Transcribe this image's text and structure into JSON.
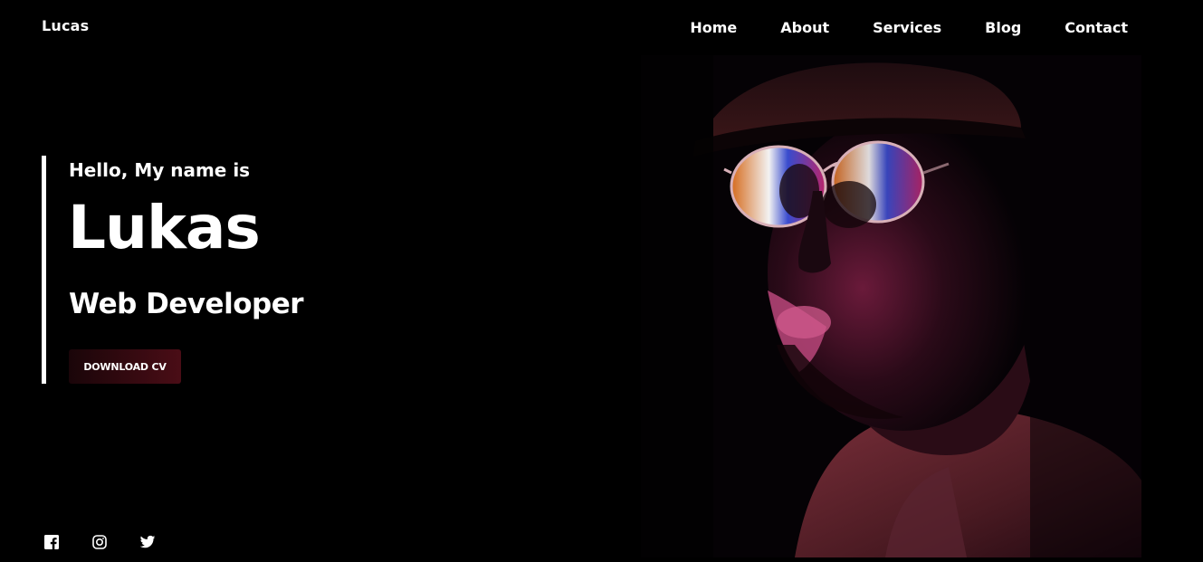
{
  "header": {
    "logo": "Lucas",
    "nav": [
      {
        "label": "Home"
      },
      {
        "label": "About"
      },
      {
        "label": "Services"
      },
      {
        "label": "Blog"
      },
      {
        "label": "Contact"
      }
    ]
  },
  "hero": {
    "greeting": "Hello, My name is",
    "name": "Lukas",
    "role": "Web Developer",
    "cta_label": "DOWNLOAD CV",
    "cta_gradient": [
      "#1a0509",
      "#4a0d16"
    ]
  },
  "socials": [
    {
      "icon": "facebook-icon"
    },
    {
      "icon": "instagram-icon"
    },
    {
      "icon": "twitter-icon"
    }
  ],
  "colors": {
    "background": "#000000",
    "text": "#ffffff",
    "accent_magenta": "#c2266f",
    "accent_orange": "#e0701e"
  }
}
